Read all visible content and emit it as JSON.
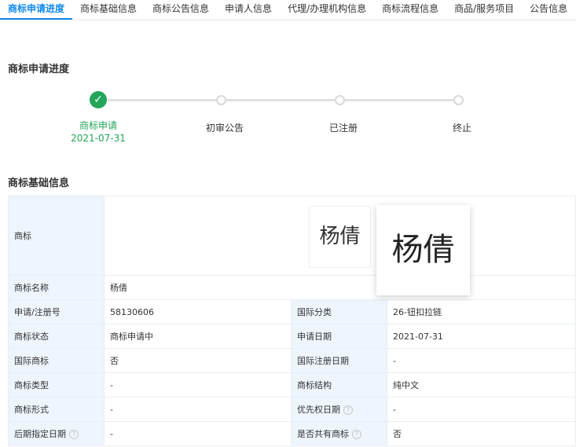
{
  "tabs": [
    "商标申请进度",
    "商标基础信息",
    "商标公告信息",
    "申请人信息",
    "代理/办理机构信息",
    "商标流程信息",
    "商品/服务项目",
    "公告信息"
  ],
  "progress": {
    "title": "商标申请进度",
    "steps": [
      {
        "label": "商标申请",
        "date": "2021-07-31",
        "done": true
      },
      {
        "label": "初审公告",
        "done": false
      },
      {
        "label": "已注册",
        "done": false
      },
      {
        "label": "终止",
        "done": false
      }
    ]
  },
  "basic": {
    "title": "商标基础信息",
    "mark_label": "商标",
    "mark_text": "杨倩",
    "name_label": "商标名称",
    "name_value": "杨倩",
    "rows": [
      {
        "l1": "申请/注册号",
        "v1": "58130606",
        "l2": "国际分类",
        "v2": "26-钮扣拉链"
      },
      {
        "l1": "商标状态",
        "v1": "商标申请中",
        "l2": "申请日期",
        "v2": "2021-07-31"
      },
      {
        "l1": "国际商标",
        "v1": "否",
        "l2": "国际注册日期",
        "v2": "-"
      },
      {
        "l1": "商标类型",
        "v1": "-",
        "l2": "商标结构",
        "v2": "纯中文"
      },
      {
        "l1": "商标形式",
        "v1": "-",
        "l2": "优先权日期",
        "v2": "-"
      },
      {
        "l1": "后期指定日期",
        "v1": "-",
        "l2": "是否共有商标",
        "v2": "否"
      }
    ]
  },
  "colors": {
    "accent": "#128bed",
    "success": "#23a55a",
    "label_bg": "#eef5fd"
  }
}
